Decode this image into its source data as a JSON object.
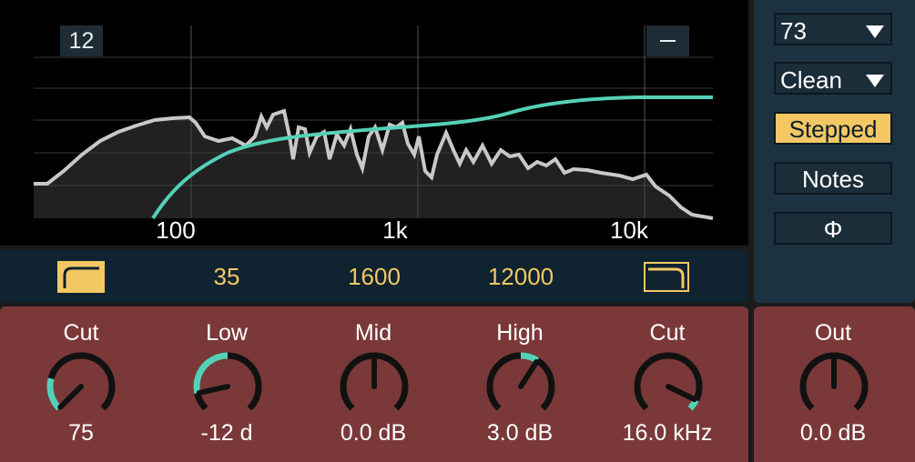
{
  "display": {
    "db_range": "12",
    "freq_axis_labels": [
      "100",
      "1k",
      "10k"
    ]
  },
  "filter_strip": {
    "lowcut_icon": "low-cut-filter-icon",
    "highcut_icon": "high-cut-filter-icon",
    "lowcut_active": true,
    "highcut_active": false,
    "low_freq": "35",
    "mid_freq": "1600",
    "high_freq": "12000"
  },
  "knobs": [
    {
      "label": "Cut",
      "value": "75",
      "level": 0.0
    },
    {
      "label": "Low",
      "value": "-12 d",
      "level": 0.12
    },
    {
      "label": "Mid",
      "value": "0.0 dB",
      "level": 0.5
    },
    {
      "label": "High",
      "value": "3.0 dB",
      "level": 0.62
    },
    {
      "label": "Cut",
      "value": "16.0 kHz",
      "level": 0.93
    }
  ],
  "output": {
    "label": "Out",
    "value": "0.0 dB",
    "level": 0.5
  },
  "side": {
    "preset_select": "73",
    "mode_select": "Clean",
    "stepped_label": "Stepped",
    "stepped_active": true,
    "notes_label": "Notes",
    "phase_symbol": "Φ"
  },
  "colors": {
    "accent": "#f3c864",
    "curve": "#55d0b8",
    "spectrum": "#c8c8c8",
    "knob_panel": "#7a3938",
    "side_panel": "#1c3240"
  }
}
